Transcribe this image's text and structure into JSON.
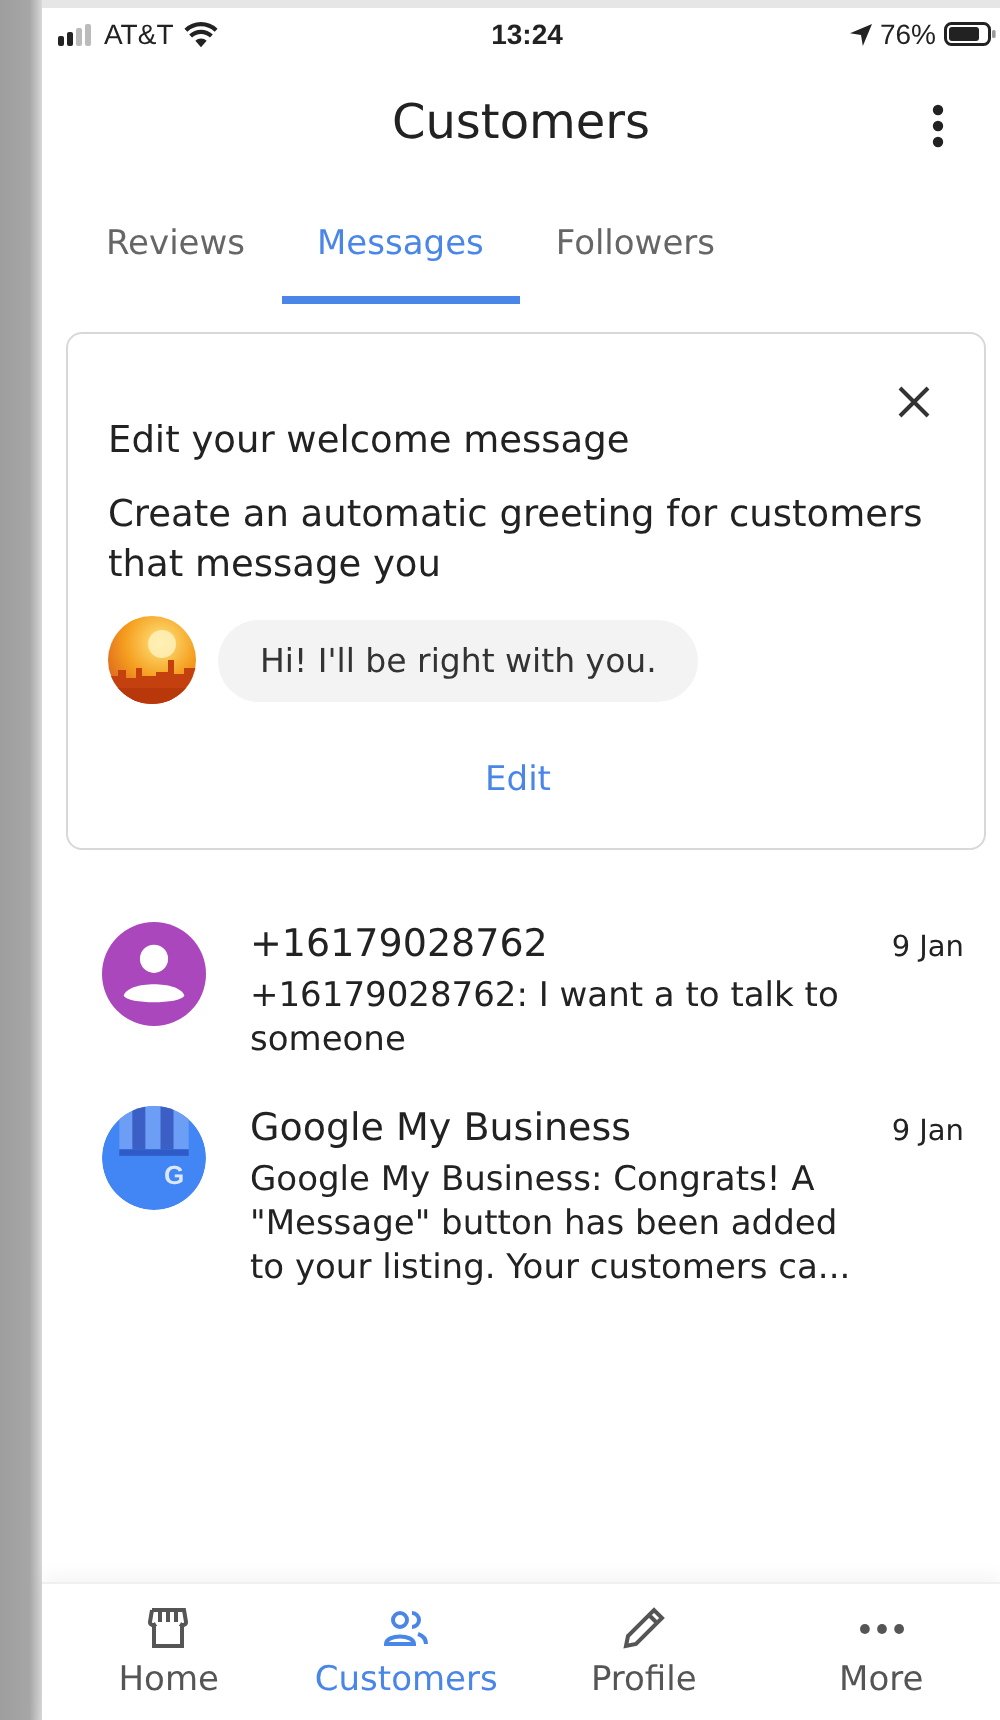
{
  "status_bar": {
    "carrier": "AT&T",
    "time": "13:24",
    "battery": "76%"
  },
  "header": {
    "title": "Customers"
  },
  "tabs": [
    {
      "label": "Reviews",
      "selected": false
    },
    {
      "label": "Messages",
      "selected": true
    },
    {
      "label": "Followers",
      "selected": false
    }
  ],
  "welcome_card": {
    "title": "Edit your welcome message",
    "description": "Create an automatic greeting for customers that message you",
    "greeting": "Hi! I'll be right with you.",
    "action": "Edit"
  },
  "messages": [
    {
      "kind": "person",
      "sender": "+16179028762",
      "date": "9 Jan",
      "preview": "+16179028762: I want a to talk to someone"
    },
    {
      "kind": "store",
      "avatar_letter": "G",
      "sender": "Google My Business",
      "date": "9 Jan",
      "preview": "Google My Business: Congrats! A \"Message\" button has been added to your listing. Your customers ca..."
    }
  ],
  "bottom_nav": [
    {
      "kind": "home",
      "label": "Home",
      "selected": false
    },
    {
      "kind": "customers",
      "label": "Customers",
      "selected": true
    },
    {
      "kind": "profile",
      "label": "Profile",
      "selected": false
    },
    {
      "kind": "more",
      "label": "More",
      "selected": false
    }
  ]
}
